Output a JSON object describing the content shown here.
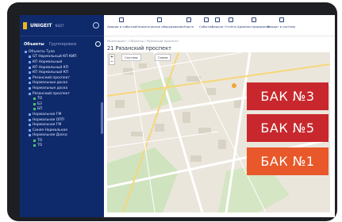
{
  "app": {
    "logo": "UNIGEIT",
    "logo_sub": "NSDT"
  },
  "sidebar": {
    "tabs": [
      "Объекты",
      "Группировки"
    ],
    "tree": [
      {
        "label": "Объекты Тула",
        "level": 0
      },
      {
        "label": "GT Нормальный КП КИП",
        "level": 1
      },
      {
        "label": "КП Нормальный",
        "level": 1
      },
      {
        "label": "КП Нормальный КП",
        "level": 1
      },
      {
        "label": "КП Нормальный КП",
        "level": 1
      },
      {
        "label": "Рязанский проспект",
        "level": 1
      },
      {
        "label": "Нормальные доска",
        "level": 1
      },
      {
        "label": "Нормальные доска",
        "level": 1
      },
      {
        "label": "Рязанский проспект",
        "level": 1
      },
      {
        "label": "ТО",
        "level": 2
      },
      {
        "label": "БЗ",
        "level": 2
      },
      {
        "label": "БП",
        "level": 2
      },
      {
        "label": "Нормальная ГМ",
        "level": 1
      },
      {
        "label": "Нормальная ОПП",
        "level": 1
      },
      {
        "label": "Нормальная ГМ",
        "level": 1
      },
      {
        "label": "Синяя Нормальная",
        "level": 1
      },
      {
        "label": "Нормальная Доска",
        "level": 1
      },
      {
        "label": "ТО",
        "level": 2
      },
      {
        "label": "ТО",
        "level": 2
      }
    ]
  },
  "toolbar": {
    "items": [
      "Аварии и события",
      "Климатическое оборудование",
      "Карта",
      "События",
      "Задачи",
      "Отчёты",
      "Администрирование",
      "Входит в систему"
    ]
  },
  "breadcrumb": "Мониторинг / Объекты / Рязанский проспект",
  "page_title": "21 Рязанский проспект",
  "map": {
    "buttons": [
      "Спутник",
      "Схема"
    ]
  },
  "badges": [
    {
      "label": "БАК №3",
      "color": "#c8282d"
    },
    {
      "label": "БАК №5",
      "color": "#c8282d"
    },
    {
      "label": "БАК №1",
      "color": "#e8582a"
    }
  ]
}
